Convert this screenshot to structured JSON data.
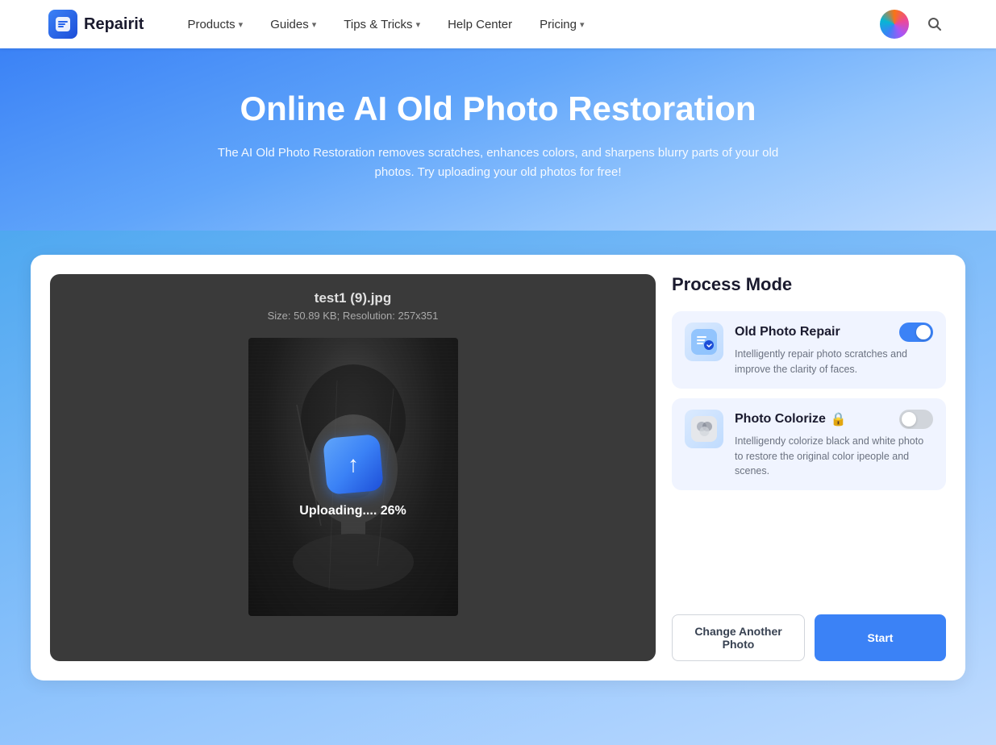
{
  "navbar": {
    "brand_icon": "R",
    "brand_name": "Repairit",
    "nav_items": [
      {
        "id": "products",
        "label": "Products",
        "has_dropdown": true
      },
      {
        "id": "guides",
        "label": "Guides",
        "has_dropdown": true
      },
      {
        "id": "tips-tricks",
        "label": "Tips & Tricks",
        "has_dropdown": true
      },
      {
        "id": "help-center",
        "label": "Help Center",
        "has_dropdown": false
      },
      {
        "id": "pricing",
        "label": "Pricing",
        "has_dropdown": true
      }
    ]
  },
  "hero": {
    "title": "Online AI Old Photo Restoration",
    "subtitle": "The AI Old Photo Restoration removes scratches, enhances colors, and sharpens blurry parts of your old photos. Try uploading your old photos for free!"
  },
  "photo_panel": {
    "filename": "test1 (9).jpg",
    "meta": "Size: 50.89 KB; Resolution: 257x351",
    "uploading_text": "Uploading.... 26%"
  },
  "process_panel": {
    "title": "Process Mode",
    "modes": [
      {
        "id": "old-photo-repair",
        "label": "Old Photo Repair",
        "icon": "🔧",
        "description": "Intelligently repair photo scratches and improve the clarity of faces.",
        "enabled": true,
        "has_lock": false
      },
      {
        "id": "photo-colorize",
        "label": "Photo Colorize",
        "icon": "🎨",
        "description": "Intelligendy colorize black and white photo to restore the original color ipeople and scenes.",
        "enabled": false,
        "has_lock": true
      }
    ],
    "change_button_label": "Change Another Photo",
    "start_button_label": "Start"
  }
}
